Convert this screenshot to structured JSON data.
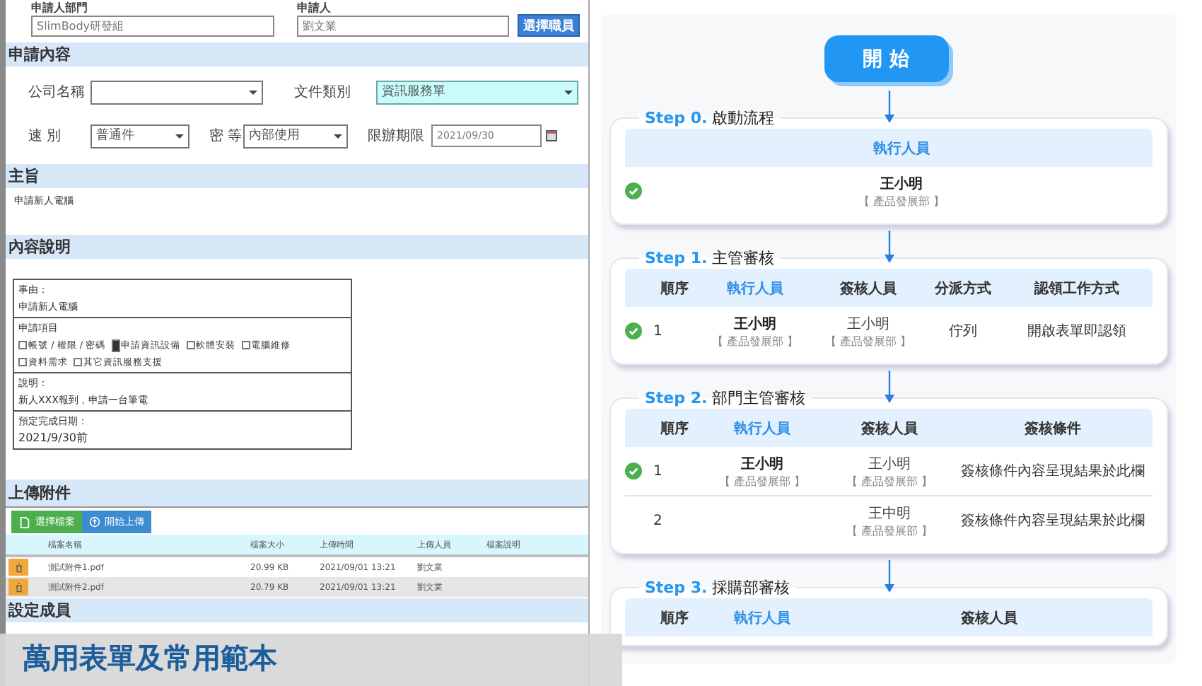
{
  "applicant": {
    "dept_label": "申請人部門",
    "dept_value": "SlimBody研發組",
    "name_label": "申請人",
    "name_value": "劉文業",
    "pick_button": "選擇職員"
  },
  "content_section": {
    "title": "申請內容",
    "company_label": "公司名稱",
    "doctype_label": "文件類別",
    "doctype_value": "資訊服務單",
    "speed_label": "速 別",
    "speed_value": "普通件",
    "secret_label": "密 等",
    "secret_value": "內部使用",
    "deadline_label": "限辦期限",
    "deadline_value": "2021/09/30"
  },
  "subject": {
    "title": "主旨",
    "text": "申請新人電腦"
  },
  "description": {
    "title": "內容說明",
    "reason_label": "事由：",
    "reason_text": "申請新人電腦",
    "items_label": "申請項目",
    "items": [
      {
        "label": "帳號 / 權限 / 密碼",
        "checked": false
      },
      {
        "label": "申請資訊設備",
        "checked": true
      },
      {
        "label": "軟體安裝",
        "checked": false
      },
      {
        "label": "電腦維修",
        "checked": false
      },
      {
        "label": "資料需求",
        "checked": false
      },
      {
        "label": "其它資訊服務支援",
        "checked": false
      }
    ],
    "note_label": "說明：",
    "note_text": "新人XXX報到，申請一台筆電",
    "due_label": "預定完成日期：",
    "due_text": "2021/9/30前"
  },
  "attachments": {
    "title": "上傳附件",
    "choose_button": "選擇檔案",
    "upload_button": "開始上傳",
    "columns": [
      "檔案名稱",
      "檔案大小",
      "上傳時間",
      "上傳人員",
      "檔案說明"
    ],
    "rows": [
      {
        "name": "測試附件1.pdf",
        "size": "20.99 KB",
        "time": "2021/09/01 13:21",
        "user": "劉文業"
      },
      {
        "name": "測試附件2.pdf",
        "size": "20.79 KB",
        "time": "2021/09/01 13:21",
        "user": "劉文業"
      }
    ]
  },
  "members": {
    "title": "設定成員"
  },
  "flow": {
    "start": "開 始",
    "steps": [
      {
        "label": "Step 0.",
        "name": "啟動流程",
        "columns": [
          {
            "label": "執行人員",
            "highlight": true
          }
        ],
        "rows": [
          {
            "done": true,
            "cells": [
              {
                "name": "王小明",
                "dept": "【 產品發展部 】"
              }
            ]
          }
        ]
      },
      {
        "label": "Step 1.",
        "name": "主管審核",
        "columns": [
          {
            "label": "順序",
            "highlight": false
          },
          {
            "label": "執行人員",
            "highlight": true
          },
          {
            "label": "簽核人員",
            "highlight": false
          },
          {
            "label": "分派方式",
            "highlight": false
          },
          {
            "label": "認領工作方式",
            "highlight": false
          }
        ],
        "rows": [
          {
            "done": true,
            "cells": [
              {
                "text": "1"
              },
              {
                "name": "王小明",
                "dept": "【 產品發展部 】"
              },
              {
                "name": "王小明",
                "dept": "【 產品發展部 】"
              },
              {
                "text": "佇列"
              },
              {
                "text": "開啟表單即認領"
              }
            ]
          }
        ]
      },
      {
        "label": "Step 2.",
        "name": "部門主管審核",
        "columns": [
          {
            "label": "順序",
            "highlight": false
          },
          {
            "label": "執行人員",
            "highlight": true
          },
          {
            "label": "簽核人員",
            "highlight": false
          },
          {
            "label": "簽核條件",
            "highlight": false
          }
        ],
        "rows": [
          {
            "done": true,
            "cells": [
              {
                "text": "1"
              },
              {
                "name": "王小明",
                "dept": "【 產品發展部 】"
              },
              {
                "name": "王小明",
                "dept": "【 產品發展部 】"
              },
              {
                "text": "簽核條件內容呈現結果於此欄"
              }
            ]
          },
          {
            "done": false,
            "cells": [
              {
                "text": "2"
              },
              {},
              {
                "name": "王中明",
                "dept": "【 產品發展部 】"
              },
              {
                "text": "簽核條件內容呈現結果於此欄"
              }
            ]
          }
        ]
      },
      {
        "label": "Step 3.",
        "name": "採購部審核",
        "columns": [
          {
            "label": "順序",
            "highlight": false
          },
          {
            "label": "執行人員",
            "highlight": true
          },
          {
            "label": "簽核人員",
            "highlight": false
          }
        ]
      }
    ]
  },
  "banner": {
    "title": "萬用表單及常用範本"
  }
}
